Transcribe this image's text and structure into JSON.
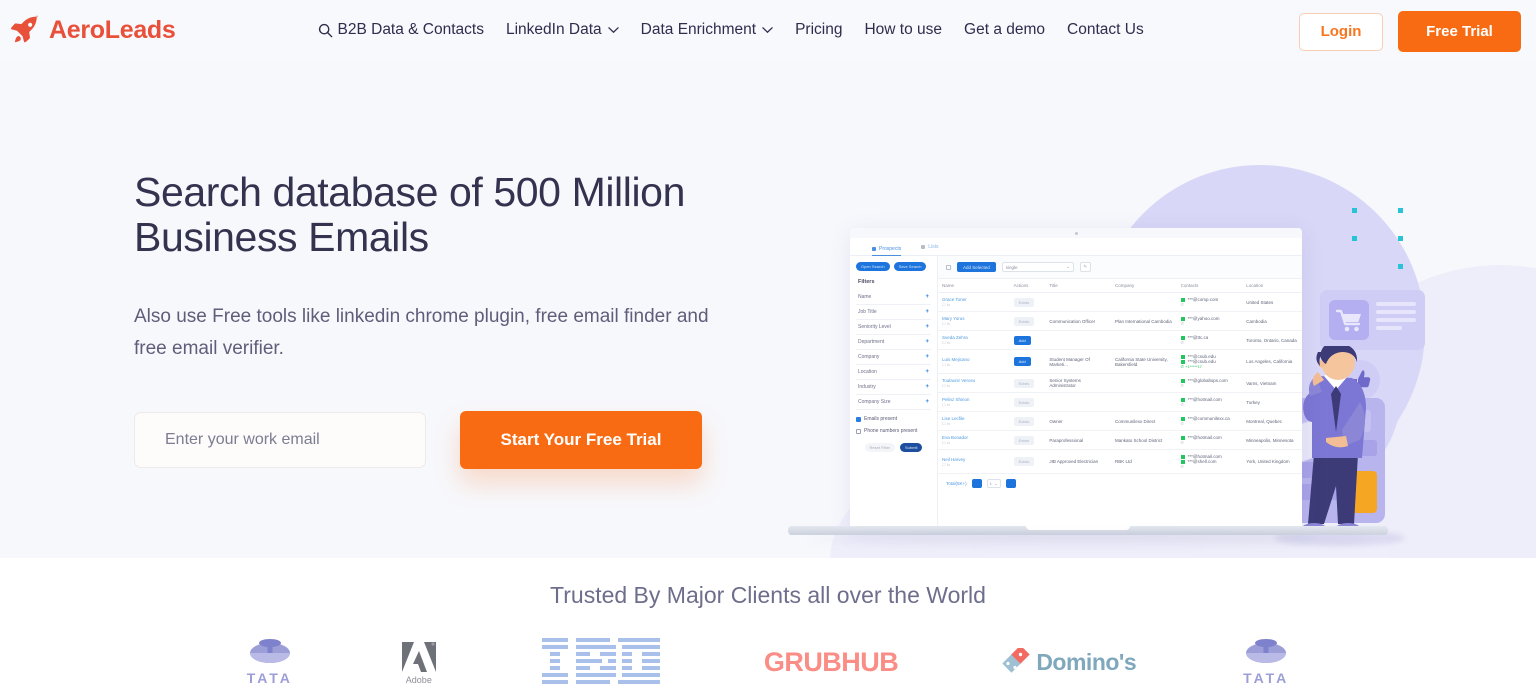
{
  "brand": {
    "name": "AeroLeads",
    "logo_icon": "rocket-icon",
    "color": "#e8503a"
  },
  "nav": {
    "items": [
      {
        "label": "B2B Data & Contacts",
        "icon": "search-icon",
        "dropdown": false
      },
      {
        "label": "LinkedIn Data",
        "icon": "",
        "dropdown": true
      },
      {
        "label": "Data Enrichment",
        "icon": "",
        "dropdown": true
      },
      {
        "label": "Pricing",
        "icon": "",
        "dropdown": false
      },
      {
        "label": "How to use",
        "icon": "",
        "dropdown": false
      },
      {
        "label": "Get a demo",
        "icon": "",
        "dropdown": false
      },
      {
        "label": "Contact Us",
        "icon": "",
        "dropdown": false
      }
    ],
    "login_label": "Login",
    "trial_label": "Free Trial",
    "accent_color": "#f96b12"
  },
  "hero": {
    "title": "Search database of 500 Million Business Emails",
    "subtitle": "Also use Free tools like linkedin chrome plugin, free email finder and free email verifier.",
    "email_placeholder": "Enter your work email",
    "email_value": "",
    "cta_label": "Start Your Free Trial",
    "bg_color": "#f7f8fc",
    "title_color": "#33334f"
  },
  "dashboard": {
    "tabs": [
      {
        "label": "Prospects",
        "active": true
      },
      {
        "label": "Lists",
        "active": false
      }
    ],
    "buttons": {
      "open_search": "Open Search",
      "save_search": "Save Search",
      "add_selected": "Add Selected"
    },
    "select_value": "single",
    "filters_heading": "Filters",
    "filter_items": [
      "Name",
      "Job Title",
      "Seniority Level",
      "Department",
      "Company",
      "Location",
      "Industry",
      "Company Size"
    ],
    "checkboxes": [
      {
        "label": "Emails present",
        "checked": true
      },
      {
        "label": "Phone numbers present",
        "checked": false
      }
    ],
    "reset_label": "Reset Filter",
    "submit_label": "Submit",
    "columns": [
      "Name",
      "Actions",
      "Title",
      "Company",
      "Contacts",
      "Location"
    ],
    "rows": [
      {
        "name": "Grace Toner",
        "action": "Exists",
        "title": "",
        "company": "",
        "emails": [
          "***@comp.com"
        ],
        "location": "United States"
      },
      {
        "name": "Mary Yorus",
        "action": "Exists",
        "title": "Communication Officer",
        "company": "Plan International Cambodia",
        "emails": [
          "***@yahoo.com"
        ],
        "location": "Cambodia"
      },
      {
        "name": "Sveda Zehra",
        "action": "Add",
        "title": "",
        "company": "",
        "emails": [
          "***@ttc.ca"
        ],
        "location": "Toronto, Ontario, Canada"
      },
      {
        "name": "Luis Mejicano",
        "action": "Add",
        "title": "Student Manager Of Marketi...",
        "company": "California State University, Bakersfield",
        "emails": [
          "***@csub.edu",
          "***@csub.edu"
        ],
        "location": "Los Angeles, California"
      },
      {
        "name": "Toulaxnir Veroso",
        "action": "Exists",
        "title": "Senior Systems Administrator",
        "company": "",
        "emails": [
          "***@globaltops.com"
        ],
        "location": "Vams, Vietnam"
      },
      {
        "name": "Pelinz Shinon",
        "action": "Exists",
        "title": "",
        "company": "",
        "emails": [
          "***@hotmail.com"
        ],
        "location": "Turkey"
      },
      {
        "name": "Lise Lecfile",
        "action": "Exists",
        "title": "Owner",
        "company": "Communilexx Direct",
        "emails": [
          "***@communilexx.ca"
        ],
        "location": "Montreal, Quebec"
      },
      {
        "name": "Eva Bonador",
        "action": "Exists",
        "title": "Paraprofessional",
        "company": "Mankato School District",
        "emails": [
          "***@hotmail.com"
        ],
        "location": "Minneapolis, Minnesota"
      },
      {
        "name": "Neil Harvey",
        "action": "Exists",
        "title": "JIB Approved Electrician",
        "company": "RBK Ltd",
        "emails": [
          "***@hotmail.com",
          "***@shell.com"
        ],
        "location": "York, United Kingdom"
      }
    ],
    "total_label": "Total(5K+)",
    "page_value": "1"
  },
  "trusted": {
    "title": "Trusted By Major Clients all over the World",
    "logos": [
      {
        "name": "TATA",
        "text": "TATA"
      },
      {
        "name": "Adobe",
        "text": "Adobe"
      },
      {
        "name": "IBM",
        "text": "IBM"
      },
      {
        "name": "GRUBHUB",
        "text": "GRUBHUB"
      },
      {
        "name": "Dominos",
        "text": "Domino's"
      },
      {
        "name": "TATA",
        "text": "TATA"
      }
    ]
  }
}
